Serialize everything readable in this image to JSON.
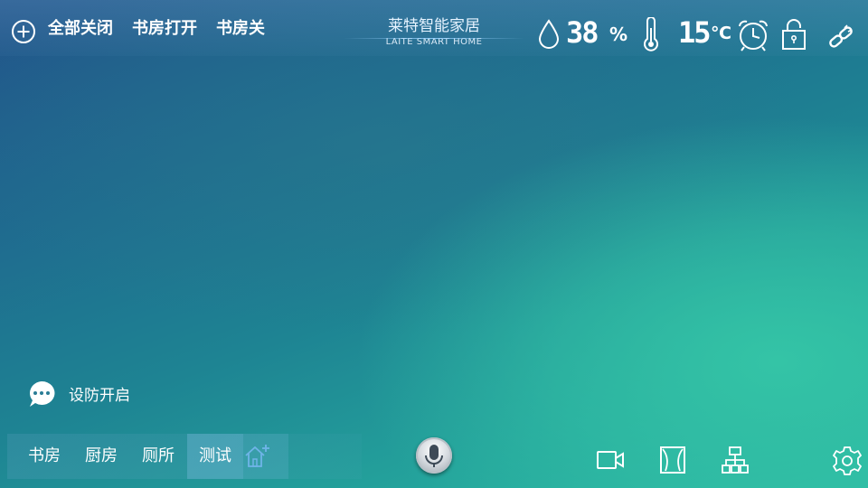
{
  "header": {
    "add_icon": "plus-circle-icon",
    "scenes": [
      {
        "label": "全部关闭"
      },
      {
        "label": "书房打开"
      },
      {
        "label": "书房关"
      }
    ],
    "brand": {
      "title": "莱特智能家居",
      "subtitle": "LAITE SMART HOME"
    },
    "humidity": {
      "icon": "droplet-icon",
      "value": "38",
      "unit": "%"
    },
    "temperature": {
      "icon": "thermometer-icon",
      "value": "15",
      "unit": "℃"
    },
    "icons": [
      "alarm-clock-icon",
      "lock-icon",
      "link-icon"
    ]
  },
  "security": {
    "icon": "chat-bubble-icon",
    "label": "设防开启"
  },
  "rooms": {
    "tabs": [
      {
        "label": "书房",
        "active": false
      },
      {
        "label": "厨房",
        "active": false
      },
      {
        "label": "厕所",
        "active": false
      },
      {
        "label": "测试",
        "active": true
      }
    ],
    "add_icon": "home-add-icon"
  },
  "voice": {
    "icon": "microphone-icon"
  },
  "footer_icons": [
    "camera-icon",
    "curtain-icon",
    "network-icon",
    "settings-gear-icon"
  ],
  "colors": {
    "bg_top": "#22548a",
    "bg_bottom": "#2cb8a4",
    "accent_glow": "#34c4a6"
  }
}
